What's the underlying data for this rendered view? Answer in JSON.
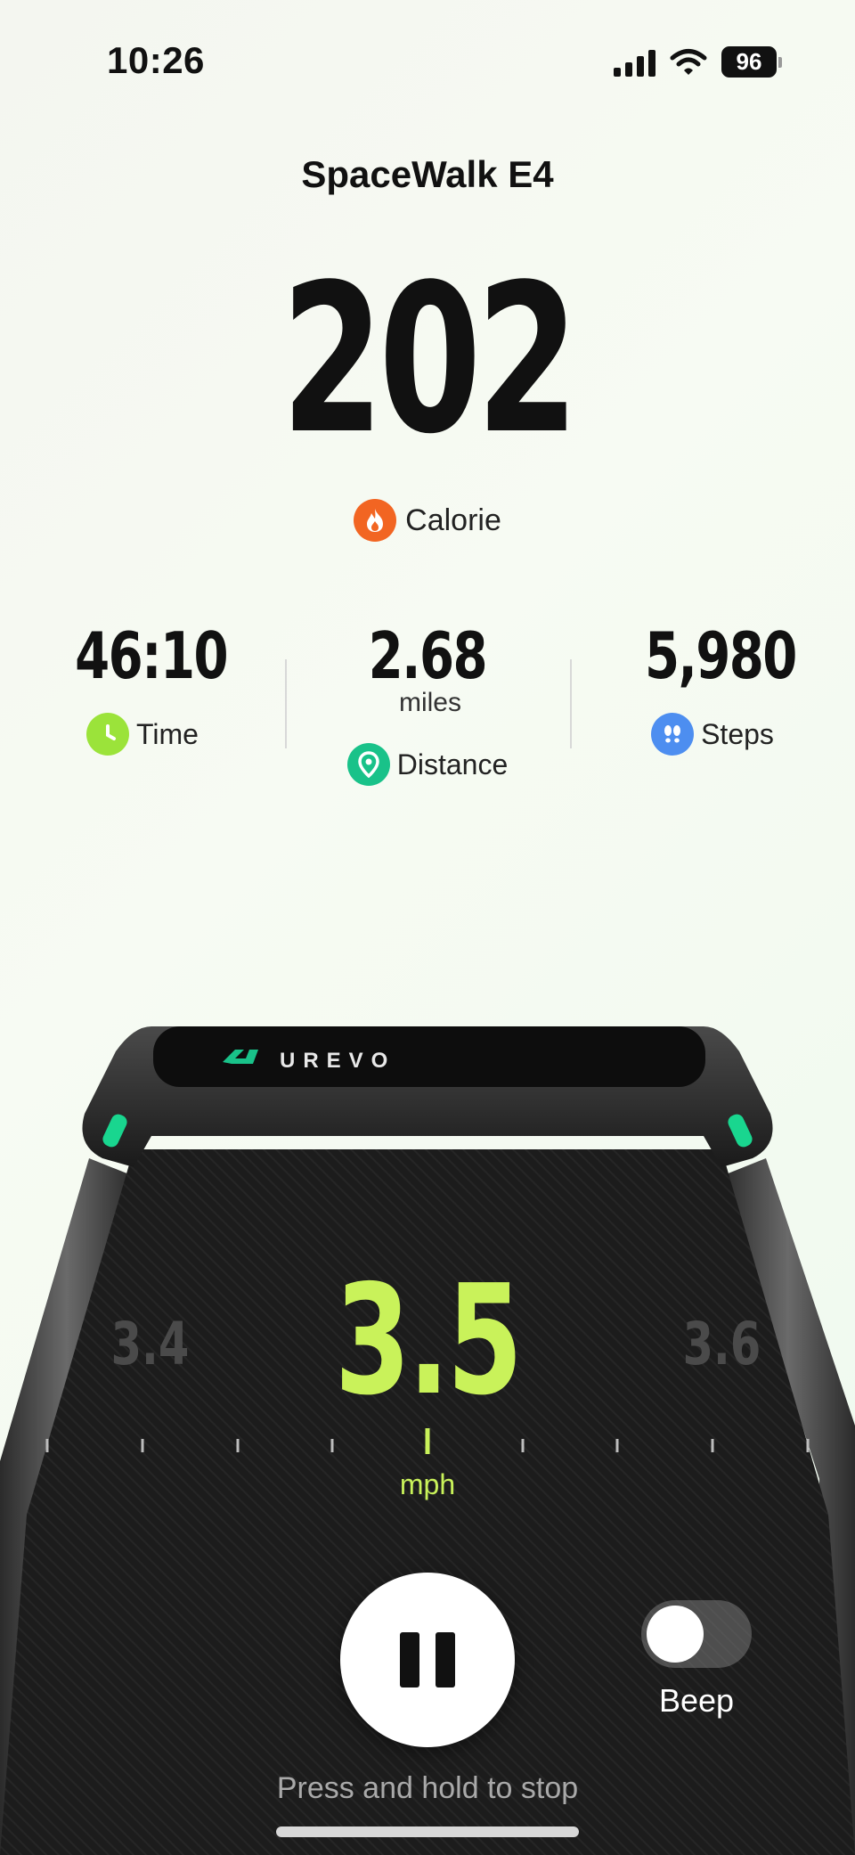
{
  "status": {
    "time": "10:26",
    "battery": "96"
  },
  "header": {
    "device_name": "SpaceWalk E4"
  },
  "calorie": {
    "value": "202",
    "label": "Calorie"
  },
  "stats": {
    "time": {
      "value": "46:10",
      "label": "Time"
    },
    "distance": {
      "value": "2.68",
      "unit": "miles",
      "label": "Distance"
    },
    "steps": {
      "value": "5,980",
      "label": "Steps"
    }
  },
  "treadmill": {
    "brand": "UREVO",
    "speed": {
      "current": "3.5",
      "previous": "3.4",
      "next": "3.6",
      "unit": "mph"
    }
  },
  "controls": {
    "beep_label": "Beep",
    "beep_enabled": false,
    "hint": "Press and hold to stop"
  },
  "colors": {
    "accent": "#c9f25a",
    "calorie_icon": "#f26522",
    "time_icon": "#9be33a",
    "distance_icon": "#19c289",
    "steps_icon": "#4d8ef0"
  }
}
